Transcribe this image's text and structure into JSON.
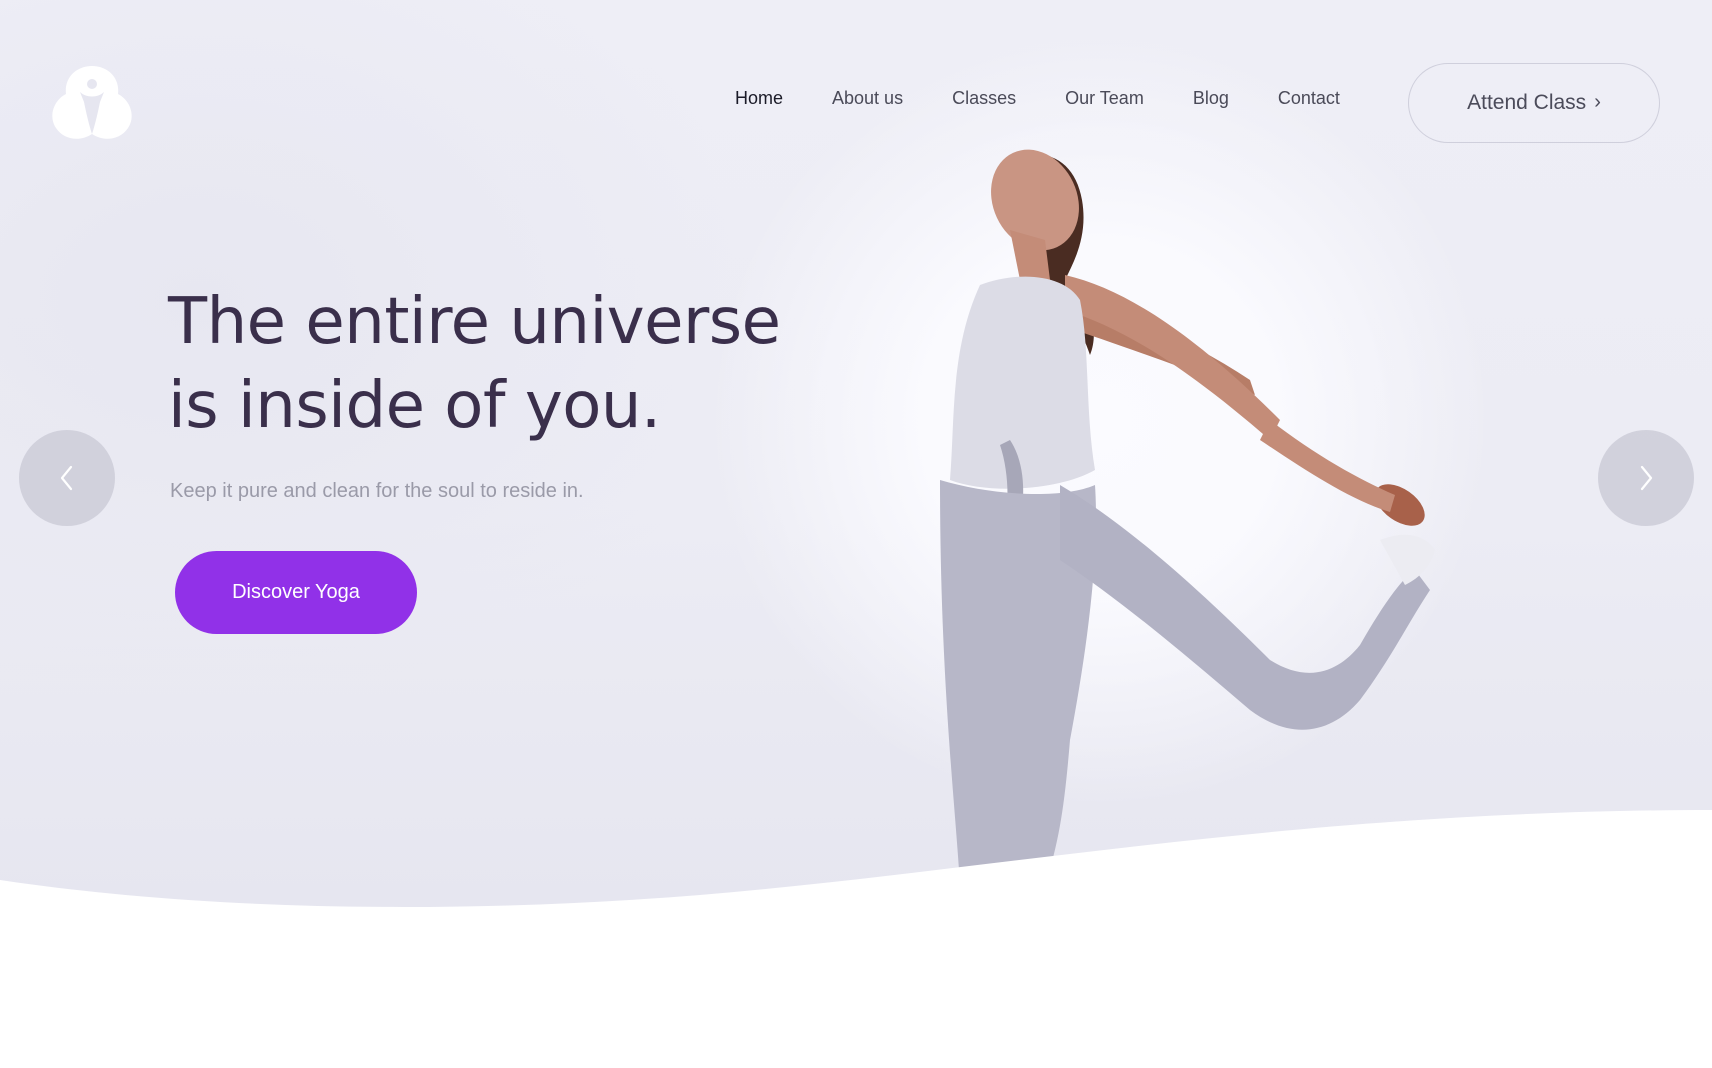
{
  "brand": {
    "logo_icon": "lotus-figure-icon"
  },
  "nav": {
    "items": [
      {
        "label": "Home",
        "active": true
      },
      {
        "label": "About us",
        "active": false
      },
      {
        "label": "Classes",
        "active": false
      },
      {
        "label": "Our Team",
        "active": false
      },
      {
        "label": "Blog",
        "active": false
      },
      {
        "label": "Contact",
        "active": false
      }
    ],
    "cta_label": "Attend Class",
    "cta_icon": "chevron-right-icon"
  },
  "hero": {
    "headline_line1": "The entire universe",
    "headline_line2": "is inside of you.",
    "subtext": "Keep it pure and clean for the soul to reside in.",
    "button_label": "Discover Yoga",
    "prev_icon": "chevron-left-icon",
    "next_icon": "chevron-right-icon",
    "image_subject": "yoga-dancer-pose-image"
  },
  "colors": {
    "accent": "#9131e8",
    "headline": "#3a2f4b",
    "nav_text": "#4a4a58",
    "subtext": "#9a9aa8",
    "background": "#eeeef6"
  }
}
